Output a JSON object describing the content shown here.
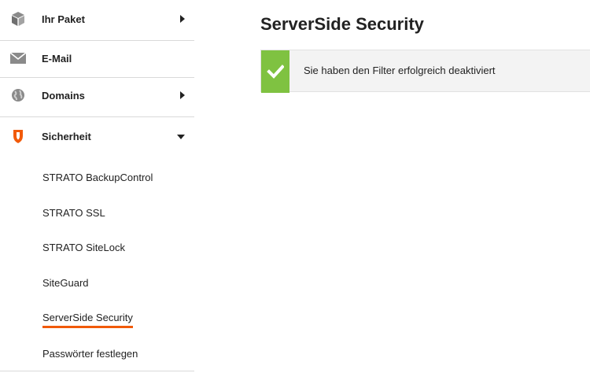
{
  "sidebar": {
    "items": [
      {
        "label": "Ihr Paket",
        "icon": "box-icon",
        "expanded": false
      },
      {
        "label": "E-Mail",
        "icon": "envelope-icon"
      },
      {
        "label": "Domains",
        "icon": "globe-icon",
        "expanded": false
      },
      {
        "label": "Sicherheit",
        "icon": "shield-icon",
        "expanded": true
      }
    ],
    "sub_items": [
      {
        "label": "STRATO BackupControl"
      },
      {
        "label": "STRATO SSL"
      },
      {
        "label": "STRATO SiteLock"
      },
      {
        "label": "SiteGuard"
      },
      {
        "label": "ServerSide Security",
        "active": true
      },
      {
        "label": "Passwörter festlegen"
      }
    ],
    "accent_color": "#f15a0a"
  },
  "main": {
    "title": "ServerSide Security",
    "alert": {
      "type": "success",
      "icon": "checkmark-icon",
      "message": "Sie haben den Filter erfolgreich deaktiviert",
      "color": "#7fc241"
    }
  }
}
